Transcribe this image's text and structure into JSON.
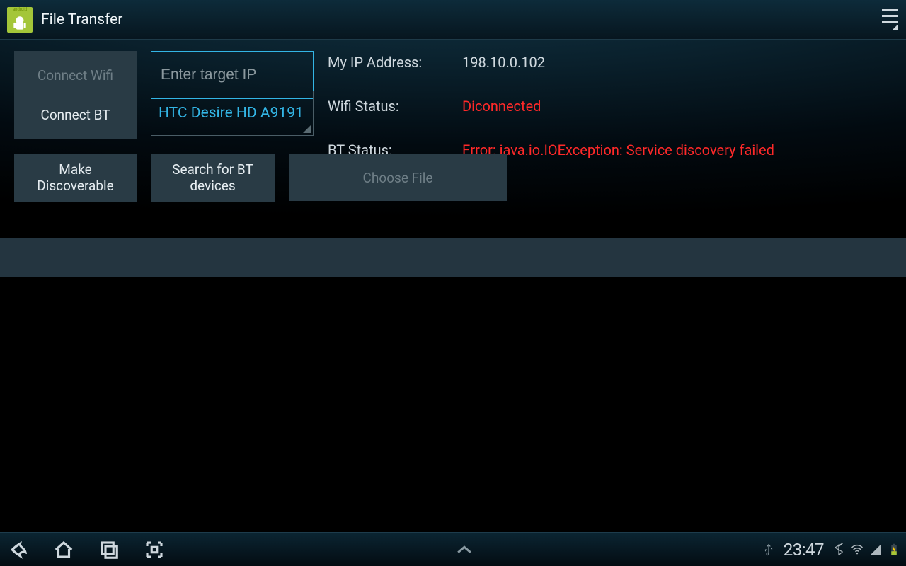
{
  "header": {
    "title": "File Transfer"
  },
  "controls": {
    "connect_wifi": "Connect Wifi",
    "connect_bt": "Connect BT",
    "make_discoverable": "Make\nDiscoverable",
    "search_bt": "Search for BT\ndevices",
    "choose_file": "Choose File",
    "ip_placeholder": "Enter target IP",
    "ip_value": "",
    "bt_device_selected": "HTC Desire HD A9191"
  },
  "info": {
    "my_ip_label": "My IP Address:",
    "my_ip_value": "198.10.0.102",
    "wifi_status_label": "Wifi Status:",
    "wifi_status_value": "Diconnected",
    "bt_status_label": "BT Status:",
    "bt_status_value": "Error: java.io.IOException: Service discovery failed"
  },
  "system": {
    "clock": "23:47"
  }
}
